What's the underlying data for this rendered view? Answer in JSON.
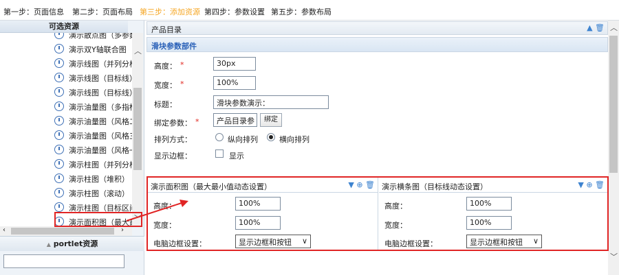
{
  "steps": {
    "s1": "第一步：页面信息",
    "s2": "第二步：页面布局",
    "s3": "第三步：添加资源",
    "s4": "第四步：参数设置",
    "s5": "第五步：参数布局"
  },
  "left": {
    "title": "可选资源",
    "items": [
      "演示散点图（多参数",
      "演示双Y轴联合图",
      "演示线图（并列分栏",
      "演示线图（目标线）",
      "演示线图（目标线）",
      "演示油量图（多指标",
      "演示油量图（风格二",
      "演示油量图（风格三",
      "演示油量图（风格一",
      "演示柱图（并列分栏",
      "演示柱图（堆积）",
      "演示柱图（滚动）",
      "演示柱图（目标区间",
      "演示面积图（最大最"
    ],
    "portlet_label": "portlet资源",
    "portlet_input": ""
  },
  "main": {
    "header_title": "产品目录",
    "section_title": "滑块参数部件",
    "height_label": "高度：",
    "height_value": "30px",
    "width_label": "宽度：",
    "width_value": "100%",
    "title_label": "标题：",
    "title_value": "滑块参数演示：",
    "bind_label": "绑定参数：",
    "bind_value": "产品目录参",
    "bind_button": "绑定",
    "arrange_label": "排列方式：",
    "arrange_vertical": "纵向排列",
    "arrange_horizontal": "横向排列",
    "border_label": "显示边框：",
    "border_option": "显示",
    "required_mark": "*"
  },
  "panels": [
    {
      "title": "演示面积图（最大最小值动态设置）",
      "height_label": "高度：",
      "height_value": "100%",
      "width_label": "宽度：",
      "width_value": "100%",
      "pc_border_label": "电脑边框设置：",
      "pc_border_value": "显示边框和按钮"
    },
    {
      "title": "演示横条图（目标线动态设置）",
      "height_label": "高度：",
      "height_value": "100%",
      "width_label": "宽度：",
      "width_value": "100%",
      "pc_border_label": "电脑边框设置：",
      "pc_border_value": "显示边框和按钮"
    }
  ],
  "colors": {
    "active_step": "#f5a623",
    "highlight": "#e02424",
    "section_title": "#2a61b8"
  }
}
